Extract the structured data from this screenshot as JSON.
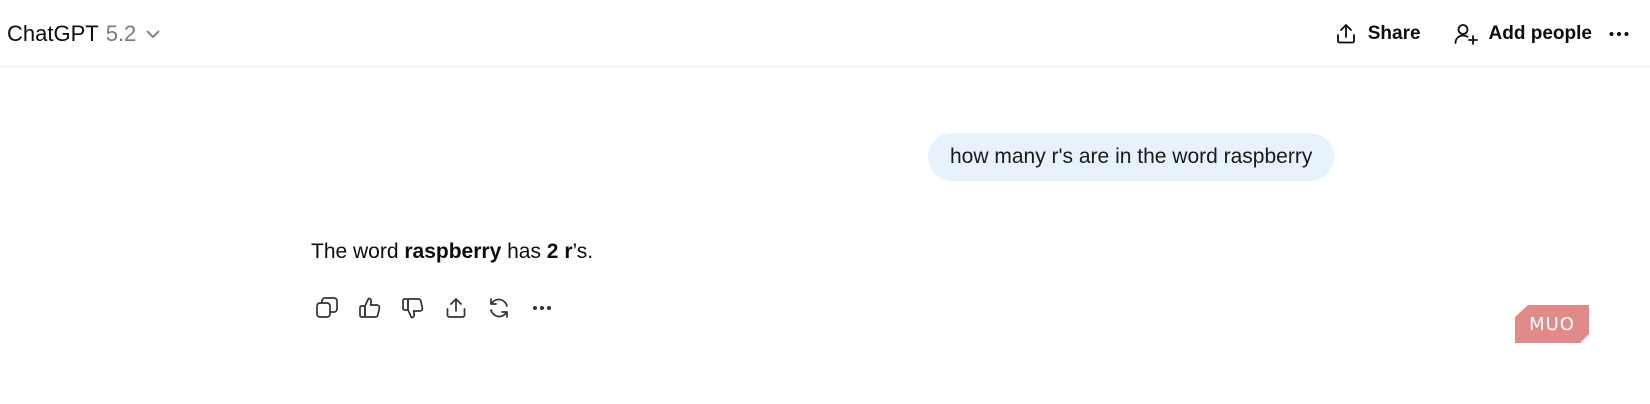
{
  "header": {
    "model_name": "ChatGPT",
    "model_version": "5.2",
    "share_label": "Share",
    "add_people_label": "Add people"
  },
  "conversation": {
    "user_message": "how many r's are in the word raspberry",
    "assistant_message": {
      "part1": "The word ",
      "bold1": "raspberry",
      "part2": " has ",
      "bold2": "2",
      "part3": " ",
      "bold3": "r",
      "part4": "’s."
    }
  },
  "message_actions": [
    "copy-icon",
    "thumbs-up-icon",
    "thumbs-down-icon",
    "share-icon",
    "regenerate-icon",
    "more-icon"
  ],
  "watermark": {
    "text": "MUO",
    "color": "#e08a8a"
  },
  "colors": {
    "user_bubble": "#e8f2fd",
    "border": "#ececec",
    "muted_text": "#7a7a7a"
  }
}
